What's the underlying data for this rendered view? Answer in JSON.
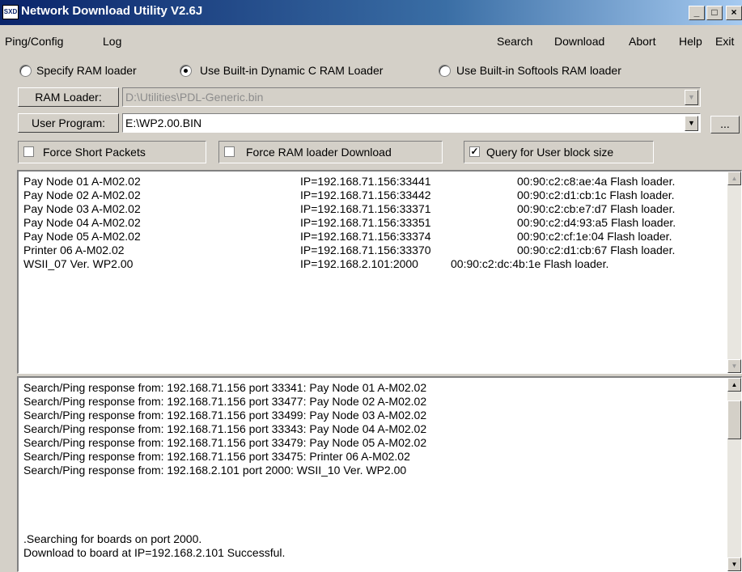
{
  "window": {
    "title": "Network Download Utility V2.6J",
    "icon_text": "SXD",
    "controls": [
      "_",
      "□",
      "×"
    ]
  },
  "menu": {
    "left": [
      "Ping/Config",
      "Log"
    ],
    "right": [
      "Search",
      "Download",
      "Abort",
      "Help",
      "Exit"
    ]
  },
  "ram_loader_options": [
    {
      "label": "Specify RAM loader",
      "selected": false
    },
    {
      "label": "Use Built-in Dynamic C RAM Loader",
      "selected": true
    },
    {
      "label": "Use Built-in Softools RAM loader",
      "selected": false
    }
  ],
  "ram_loader": {
    "label": "RAM Loader:",
    "value": "D:\\Utilities\\PDL-Generic.bin",
    "enabled": false
  },
  "user_program": {
    "label": "User Program:",
    "value": "E:\\WP2.00.BIN",
    "browse_label": "..."
  },
  "options": [
    {
      "label": "Force Short Packets",
      "checked": false
    },
    {
      "label": "Force RAM loader Download",
      "checked": false
    },
    {
      "label": "Query for User block size",
      "checked": true
    }
  ],
  "devices": [
    {
      "name": "Pay Node 01  A-M02.02",
      "ip": "IP=192.168.71.156:33441",
      "mac": "00:90:c2:c8:ae:4a Flash loader."
    },
    {
      "name": "Pay Node 02  A-M02.02",
      "ip": "IP=192.168.71.156:33442",
      "mac": "00:90:c2:d1:cb:1c Flash loader."
    },
    {
      "name": "Pay Node 03  A-M02.02",
      "ip": "IP=192.168.71.156:33371",
      "mac": "00:90:c2:cb:e7:d7 Flash loader."
    },
    {
      "name": "Pay Node 04  A-M02.02",
      "ip": "IP=192.168.71.156:33351",
      "mac": "00:90:c2:d4:93:a5 Flash loader."
    },
    {
      "name": "Pay Node 05  A-M02.02",
      "ip": "IP=192.168.71.156:33374",
      "mac": "00:90:c2:cf:1e:04 Flash loader."
    },
    {
      "name": "Printer 06  A-M02.02",
      "ip": "IP=192.168.71.156:33370",
      "mac": "00:90:c2:d1:cb:67 Flash loader."
    },
    {
      "name": "WSII_07 Ver. WP2.00",
      "ip": "IP=192.168.2.101:2000",
      "mac": "00:90:c2:dc:4b:1e Flash loader."
    }
  ],
  "log": [
    "Search/Ping response from: 192.168.71.156 port 33341: Pay Node 01  A-M02.02",
    "Search/Ping response from: 192.168.71.156 port 33477: Pay Node 02  A-M02.02",
    "Search/Ping response from: 192.168.71.156 port 33499: Pay Node 03  A-M02.02",
    "Search/Ping response from: 192.168.71.156 port 33343: Pay Node 04  A-M02.02",
    "Search/Ping response from: 192.168.71.156 port 33479: Pay Node 05  A-M02.02",
    "Search/Ping response from: 192.168.71.156 port 33475: Printer 06  A-M02.02",
    "Search/Ping response from: 192.168.2.101 port 2000: WSII_10 Ver. WP2.00",
    "",
    "",
    ".Searching for boards on port 2000.",
    "Download to board at IP=192.168.2.101 Successful."
  ],
  "glyphs": {
    "scroll_up": "▲",
    "scroll_down": "▼",
    "dropdown": "▼",
    "check": "✓"
  }
}
